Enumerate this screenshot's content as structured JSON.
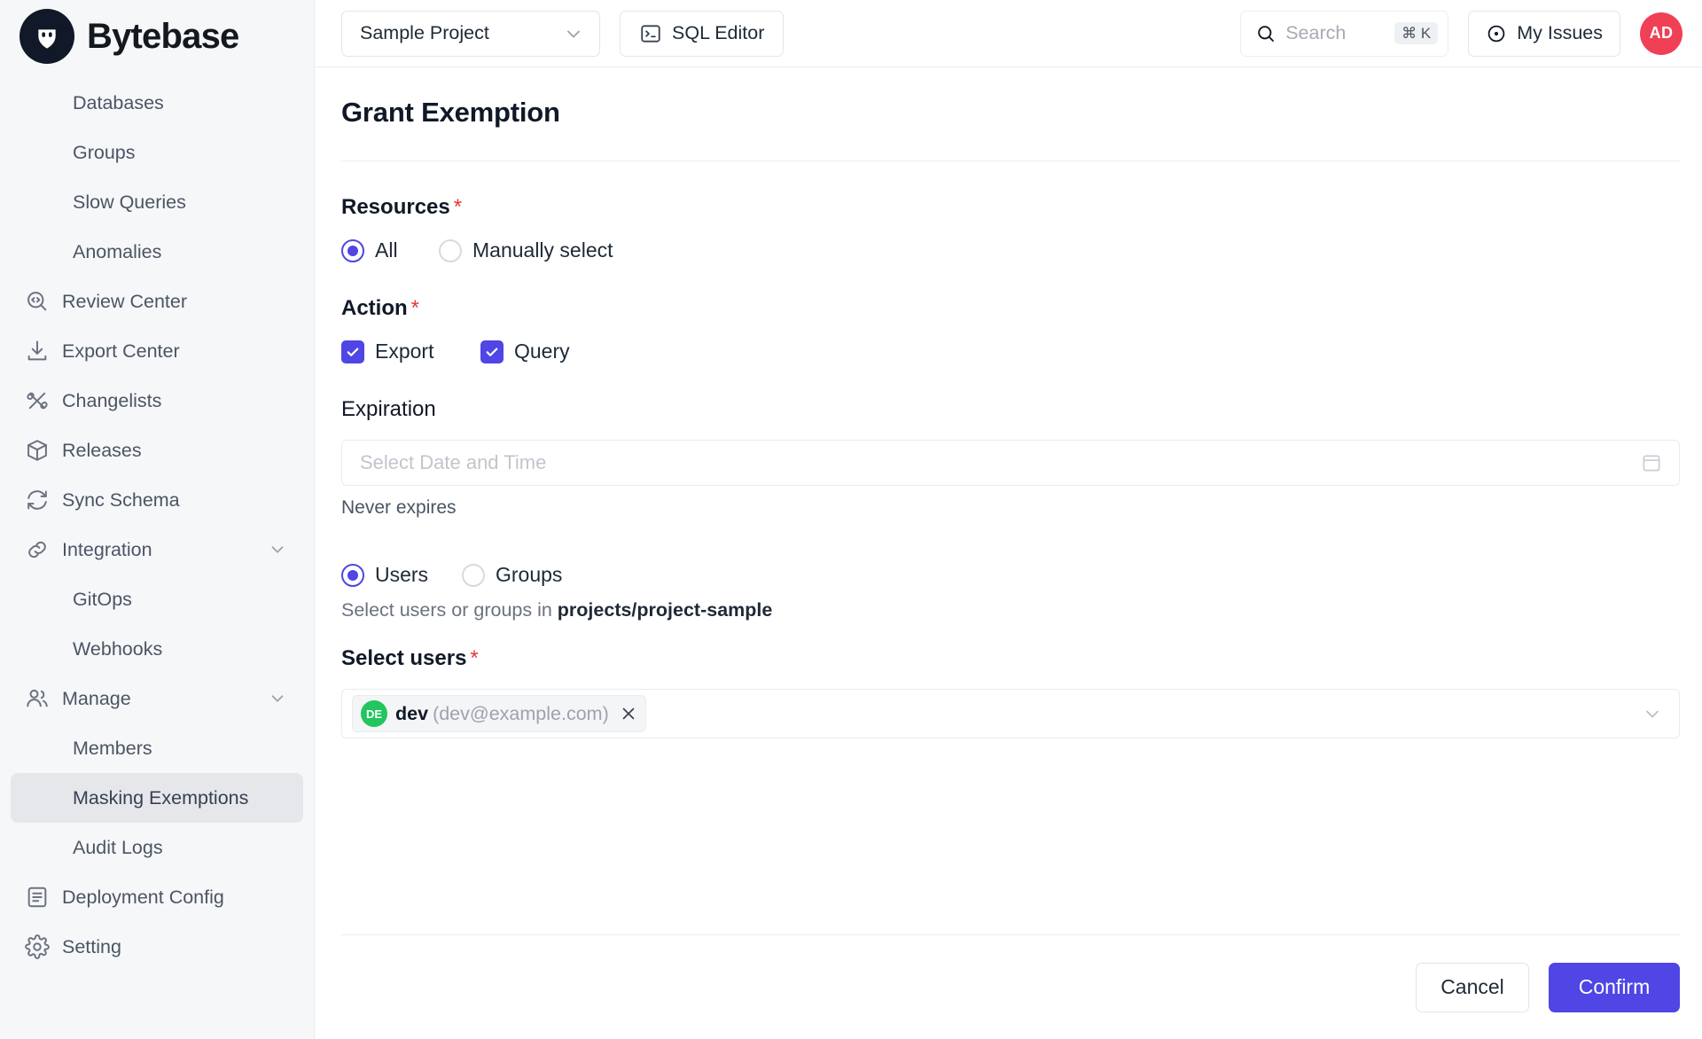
{
  "brand": {
    "name": "Bytebase",
    "logo_icon": "bytebase-logo-icon"
  },
  "sidebar": {
    "items": [
      {
        "label": "Databases",
        "icon": "",
        "level": "child",
        "active": false,
        "expandable": false
      },
      {
        "label": "Groups",
        "icon": "",
        "level": "child",
        "active": false,
        "expandable": false
      },
      {
        "label": "Slow Queries",
        "icon": "",
        "level": "child",
        "active": false,
        "expandable": false
      },
      {
        "label": "Anomalies",
        "icon": "",
        "level": "child",
        "active": false,
        "expandable": false
      },
      {
        "label": "Review Center",
        "icon": "review-icon",
        "level": "parent",
        "active": false,
        "expandable": false
      },
      {
        "label": "Export Center",
        "icon": "download-icon",
        "level": "parent",
        "active": false,
        "expandable": false
      },
      {
        "label": "Changelists",
        "icon": "changelist-icon",
        "level": "parent",
        "active": false,
        "expandable": false
      },
      {
        "label": "Releases",
        "icon": "package-icon",
        "level": "parent",
        "active": false,
        "expandable": false
      },
      {
        "label": "Sync Schema",
        "icon": "sync-icon",
        "level": "parent",
        "active": false,
        "expandable": false
      },
      {
        "label": "Integration",
        "icon": "link-icon",
        "level": "parent",
        "active": false,
        "expandable": true
      },
      {
        "label": "GitOps",
        "icon": "",
        "level": "child",
        "active": false,
        "expandable": false
      },
      {
        "label": "Webhooks",
        "icon": "",
        "level": "child",
        "active": false,
        "expandable": false
      },
      {
        "label": "Manage",
        "icon": "users-icon",
        "level": "parent",
        "active": false,
        "expandable": true
      },
      {
        "label": "Members",
        "icon": "",
        "level": "child",
        "active": false,
        "expandable": false
      },
      {
        "label": "Masking Exemptions",
        "icon": "",
        "level": "child",
        "active": true,
        "expandable": false
      },
      {
        "label": "Audit Logs",
        "icon": "",
        "level": "child",
        "active": false,
        "expandable": false
      },
      {
        "label": "Deployment Config",
        "icon": "document-icon",
        "level": "parent",
        "active": false,
        "expandable": false
      },
      {
        "label": "Setting",
        "icon": "gear-icon",
        "level": "parent",
        "active": false,
        "expandable": false
      }
    ]
  },
  "topbar": {
    "project": "Sample Project",
    "sql_editor": "SQL Editor",
    "search_placeholder": "Search",
    "search_shortcut": "⌘ K",
    "my_issues": "My Issues",
    "avatar_initials": "AD",
    "avatar_color": "#ef4056"
  },
  "page": {
    "title": "Grant Exemption",
    "resources": {
      "label": "Resources",
      "required": "*",
      "options": [
        {
          "label": "All",
          "selected": true
        },
        {
          "label": "Manually select",
          "selected": false
        }
      ]
    },
    "action": {
      "label": "Action",
      "required": "*",
      "options": [
        {
          "label": "Export",
          "checked": true
        },
        {
          "label": "Query",
          "checked": true
        }
      ]
    },
    "expiration": {
      "label": "Expiration",
      "placeholder": "Select Date and Time",
      "value": "",
      "hint": "Never expires",
      "calendar_icon": "calendar-icon"
    },
    "principal": {
      "options": [
        {
          "label": "Users",
          "selected": true
        },
        {
          "label": "Groups",
          "selected": false
        }
      ],
      "hint_prefix": "Select users or groups in ",
      "hint_resource": "projects/project-sample"
    },
    "select_users": {
      "label": "Select users",
      "required": "*",
      "tags": [
        {
          "initials": "DE",
          "name": "dev",
          "email": "(dev@example.com)",
          "avatar_color": "#22c55e"
        }
      ]
    },
    "footer": {
      "cancel": "Cancel",
      "confirm": "Confirm",
      "accent_color": "#4f46e5"
    }
  }
}
